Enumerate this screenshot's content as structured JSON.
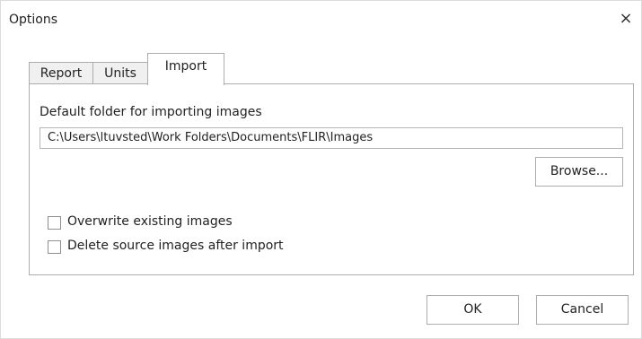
{
  "dialog": {
    "title": "Options",
    "close_glyph": "×"
  },
  "tabs": [
    {
      "label": "Report",
      "active": false
    },
    {
      "label": "Units",
      "active": false
    },
    {
      "label": "Import",
      "active": true
    }
  ],
  "import_panel": {
    "folder_label": "Default folder for importing images",
    "folder_path": "C:\\Users\\ltuvsted\\Work Folders\\Documents\\FLIR\\Images",
    "browse_label": "Browse...",
    "overwrite_label": "Overwrite existing images",
    "overwrite_checked": false,
    "delete_label": "Delete source images after import",
    "delete_checked": false
  },
  "footer": {
    "ok_label": "OK",
    "cancel_label": "Cancel"
  },
  "icons": {
    "close": "close-icon"
  }
}
